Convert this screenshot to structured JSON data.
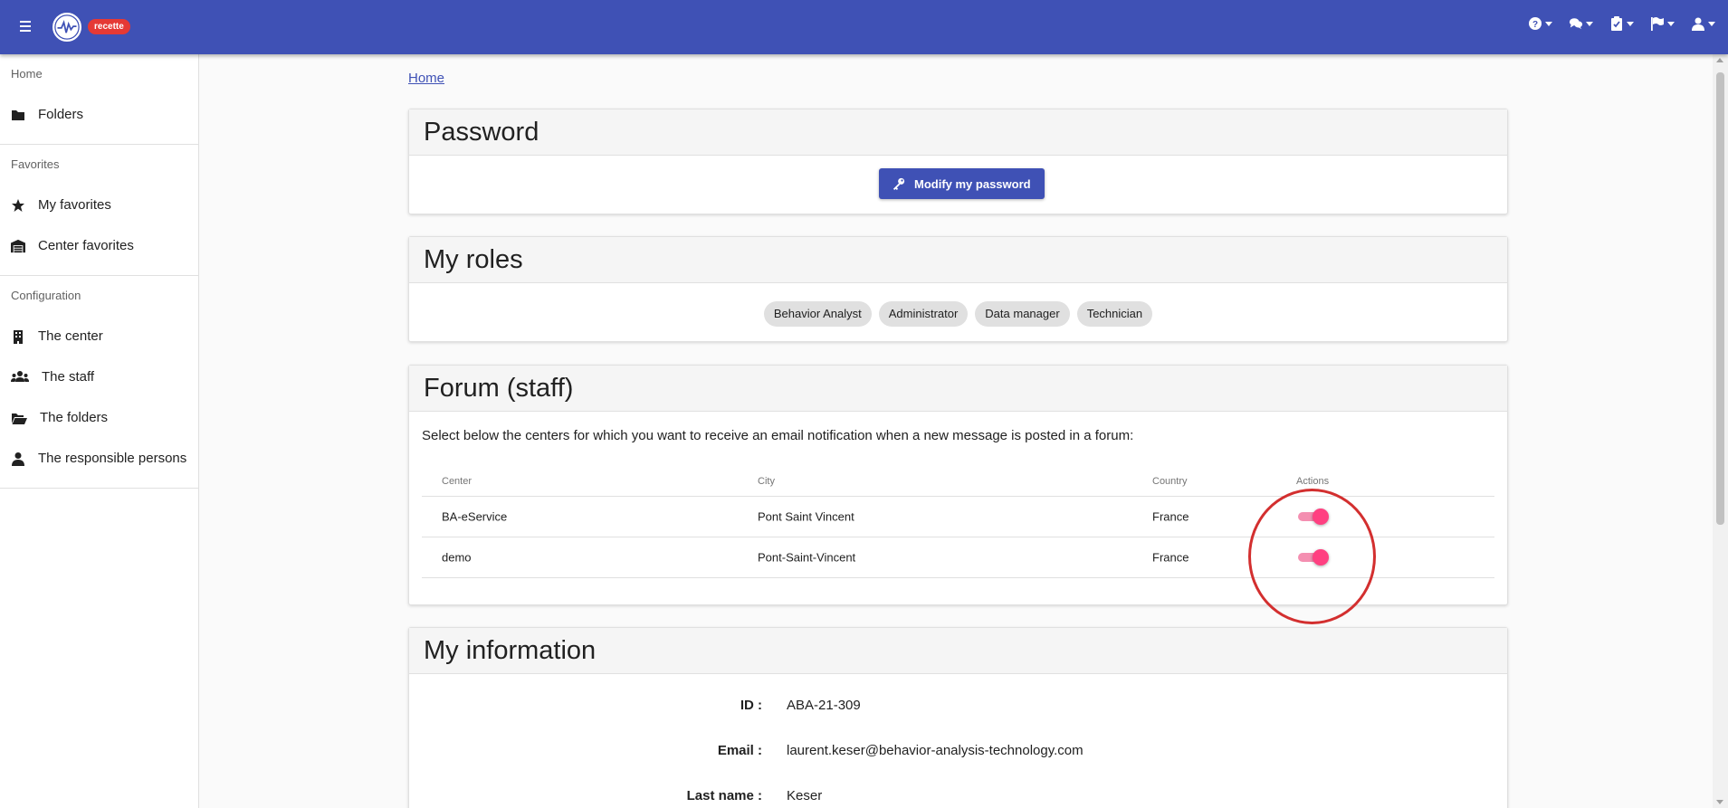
{
  "app": {
    "env_badge": "recette"
  },
  "colors": {
    "primary": "#3f51b5",
    "accent": "#ff4081",
    "badge": "#e53935",
    "annotation": "#d32f2f"
  },
  "topbar": {
    "icons": [
      "help-icon",
      "chat-icon",
      "clipboard-check-icon",
      "flag-icon",
      "user-icon"
    ]
  },
  "sidebar": {
    "sections": [
      {
        "title": "Home",
        "items": [
          {
            "label": "Folders",
            "icon": "folder-icon"
          }
        ]
      },
      {
        "title": "Favorites",
        "items": [
          {
            "label": "My favorites",
            "icon": "star-icon"
          },
          {
            "label": "Center favorites",
            "icon": "warehouse-icon"
          }
        ]
      },
      {
        "title": "Configuration",
        "items": [
          {
            "label": "The center",
            "icon": "building-icon"
          },
          {
            "label": "The staff",
            "icon": "users-icon"
          },
          {
            "label": "The folders",
            "icon": "folder-open-icon"
          },
          {
            "label": "The responsible persons",
            "icon": "user-tie-icon"
          }
        ]
      }
    ]
  },
  "breadcrumb": "Home",
  "password_card": {
    "title": "Password",
    "button_label": "Modify my password"
  },
  "roles_card": {
    "title": "My roles",
    "roles": [
      "Behavior Analyst",
      "Administrator",
      "Data manager",
      "Technician"
    ]
  },
  "forum_card": {
    "title": "Forum (staff)",
    "description": "Select below the centers for which you want to receive an email notification when a new message is posted in a forum:",
    "columns": [
      "Center",
      "City",
      "Country",
      "Actions"
    ],
    "rows": [
      {
        "center": "BA-eService",
        "city": "Pont Saint Vincent",
        "country": "France",
        "enabled": true
      },
      {
        "center": "demo",
        "city": "Pont-Saint-Vincent",
        "country": "France",
        "enabled": true
      }
    ]
  },
  "info_card": {
    "title": "My information",
    "fields": [
      {
        "label": "ID :",
        "value": "ABA-21-309"
      },
      {
        "label": "Email :",
        "value": "laurent.keser@behavior-analysis-technology.com"
      },
      {
        "label": "Last name :",
        "value": "Keser"
      }
    ]
  }
}
